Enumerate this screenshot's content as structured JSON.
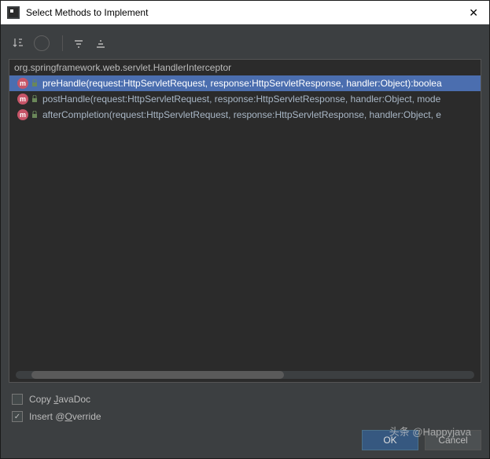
{
  "window": {
    "title": "Select Methods to Implement"
  },
  "source": {
    "class_name": "org.springframework.web.servlet.HandlerInterceptor"
  },
  "methods": [
    {
      "selected": true,
      "label": "preHandle(request:HttpServletRequest, response:HttpServletResponse, handler:Object):boolea"
    },
    {
      "selected": false,
      "label": "postHandle(request:HttpServletRequest, response:HttpServletResponse, handler:Object, mode"
    },
    {
      "selected": false,
      "label": "afterCompletion(request:HttpServletRequest, response:HttpServletResponse, handler:Object, e"
    }
  ],
  "options": {
    "copy_javadoc": {
      "label_pre": "Copy ",
      "mnemonic": "J",
      "label_post": "avaDoc",
      "checked": false
    },
    "insert_override": {
      "label_pre": "Insert @",
      "mnemonic": "O",
      "label_post": "verride",
      "checked": true
    }
  },
  "buttons": {
    "ok": "OK",
    "cancel": "Cancel"
  },
  "watermark": "头条 @Happyjava"
}
